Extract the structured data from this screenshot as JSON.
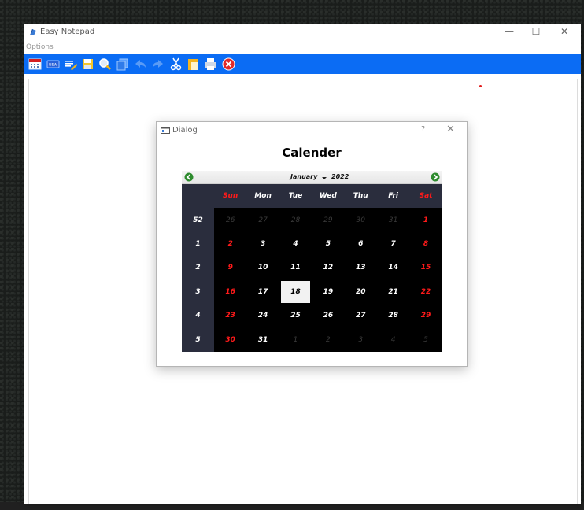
{
  "app": {
    "title": "Easy Notepad",
    "menu": [
      "Options"
    ]
  },
  "window_controls": {
    "minimize": "—",
    "maximize": "☐",
    "close": "✕"
  },
  "toolbar": {
    "buttons": [
      {
        "name": "calendar-icon"
      },
      {
        "name": "new-icon"
      },
      {
        "name": "edit-icon"
      },
      {
        "name": "save-icon"
      },
      {
        "name": "find-icon"
      },
      {
        "name": "copy-icon"
      },
      {
        "name": "undo-icon"
      },
      {
        "name": "redo-icon"
      },
      {
        "name": "cut-icon"
      },
      {
        "name": "paste-icon"
      },
      {
        "name": "print-icon"
      },
      {
        "name": "exit-icon"
      }
    ]
  },
  "dialog": {
    "title": "Dialog",
    "help": "?",
    "close": "✕",
    "heading": "Calender"
  },
  "calendar": {
    "month": "January",
    "year": "2022",
    "weekdays": [
      "Sun",
      "Mon",
      "Tue",
      "Wed",
      "Thu",
      "Fri",
      "Sat"
    ],
    "selected_day": "18",
    "weeks": [
      {
        "num": "52",
        "days": [
          {
            "d": "26",
            "o": true
          },
          {
            "d": "27",
            "o": true
          },
          {
            "d": "28",
            "o": true
          },
          {
            "d": "29",
            "o": true
          },
          {
            "d": "30",
            "o": true
          },
          {
            "d": "31",
            "o": true
          },
          {
            "d": "1"
          }
        ]
      },
      {
        "num": "1",
        "days": [
          {
            "d": "2"
          },
          {
            "d": "3"
          },
          {
            "d": "4"
          },
          {
            "d": "5"
          },
          {
            "d": "6"
          },
          {
            "d": "7"
          },
          {
            "d": "8"
          }
        ]
      },
      {
        "num": "2",
        "days": [
          {
            "d": "9"
          },
          {
            "d": "10"
          },
          {
            "d": "11"
          },
          {
            "d": "12"
          },
          {
            "d": "13"
          },
          {
            "d": "14"
          },
          {
            "d": "15"
          }
        ]
      },
      {
        "num": "3",
        "days": [
          {
            "d": "16"
          },
          {
            "d": "17"
          },
          {
            "d": "18"
          },
          {
            "d": "19"
          },
          {
            "d": "20"
          },
          {
            "d": "21"
          },
          {
            "d": "22"
          }
        ]
      },
      {
        "num": "4",
        "days": [
          {
            "d": "23"
          },
          {
            "d": "24"
          },
          {
            "d": "25"
          },
          {
            "d": "26"
          },
          {
            "d": "27"
          },
          {
            "d": "28"
          },
          {
            "d": "29"
          }
        ]
      },
      {
        "num": "5",
        "days": [
          {
            "d": "30"
          },
          {
            "d": "31"
          },
          {
            "d": "1",
            "o": true
          },
          {
            "d": "2",
            "o": true
          },
          {
            "d": "3",
            "o": true
          },
          {
            "d": "4",
            "o": true
          },
          {
            "d": "5",
            "o": true
          }
        ]
      }
    ]
  },
  "colors": {
    "toolbar": "#0b6cf4",
    "weekend": "#ff1a1a",
    "calendar_header": "#2a2d3d"
  }
}
